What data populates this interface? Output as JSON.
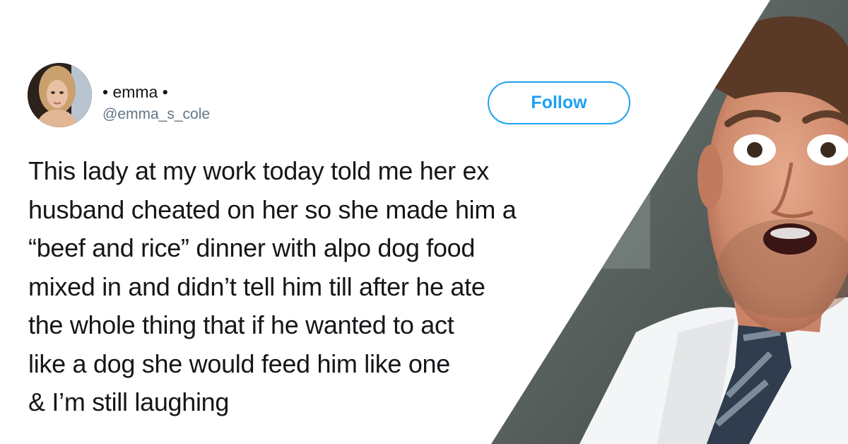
{
  "tweet": {
    "display_name": "• emma •",
    "handle": "@emma_s_cole",
    "follow_label": "Follow",
    "text_lines": [
      "This lady at my work today told me her ex",
      "husband cheated on her so she made him a",
      "“beef and rice” dinner with alpo dog food",
      "mixed in and didn’t tell him till after he ate",
      "the whole thing that if he wanted to act",
      "like a dog she would feed him like one",
      "& I’m still laughing"
    ]
  },
  "colors": {
    "twitter_blue": "#1da1f2",
    "text_primary": "#14171a",
    "text_secondary": "#657786"
  },
  "images": {
    "avatar": "user-avatar-photo",
    "reaction": "surprised-man-reaction-photo"
  }
}
